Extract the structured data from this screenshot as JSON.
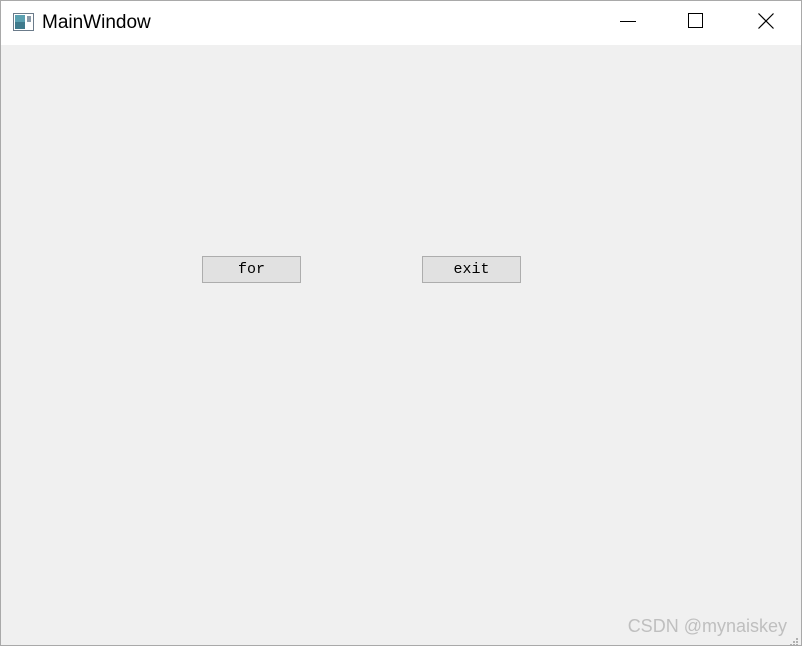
{
  "window": {
    "title": "MainWindow",
    "icons": {
      "app": "app-window-icon",
      "minimize": "minimize-icon",
      "maximize": "maximize-icon",
      "close": "close-icon"
    }
  },
  "main": {
    "buttons": {
      "for_label": "for",
      "exit_label": "exit"
    }
  },
  "watermark": {
    "text": "CSDN @mynaiskey"
  },
  "colors": {
    "client_background": "#f0f0f0",
    "titlebar_background": "#ffffff",
    "button_face": "#e1e1e1",
    "button_border": "#adadad"
  }
}
